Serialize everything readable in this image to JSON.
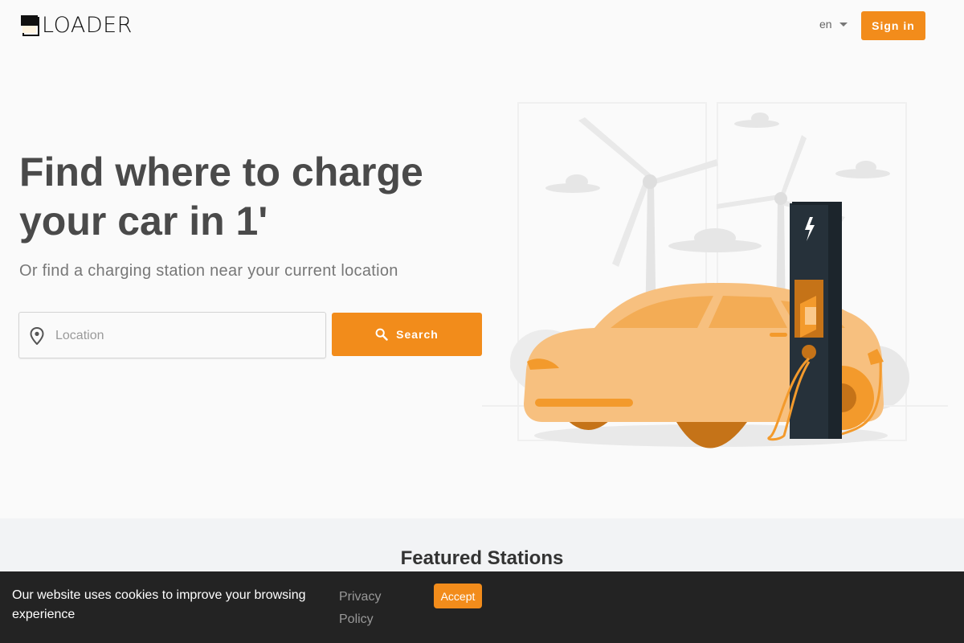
{
  "header": {
    "logo_text": "LOADER",
    "language": "en",
    "signin_label": "Sign in"
  },
  "hero": {
    "title": "Find where to charge your car in 1'",
    "subtitle": "Or find a charging station near your current location",
    "location_placeholder": "Location",
    "location_value": "",
    "search_label": "Search"
  },
  "featured": {
    "title": "Featured Stations"
  },
  "cookie": {
    "message": "Our website uses cookies to improve your browsing experience",
    "privacy_label": "Privacy Policy",
    "accept_label": "Accept"
  },
  "icons": {
    "logo": "logo-icon",
    "language_caret": "caret-down-icon",
    "location": "map-pin-icon",
    "search": "search-icon"
  },
  "colors": {
    "accent": "#f28c1b",
    "title_text": "#4a4a4a",
    "cookie_bar": "#232323",
    "featured_bg": "#f2f3f5"
  }
}
